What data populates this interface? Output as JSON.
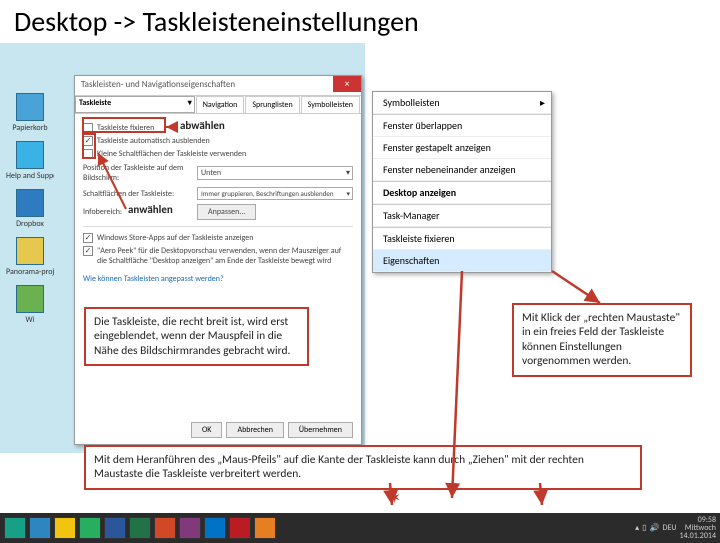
{
  "title": "Desktop -> Taskleisteneinstellungen",
  "desktop_icons": [
    {
      "label": "Papierkorb"
    },
    {
      "label": "Help and Support"
    },
    {
      "label": "Dropbox"
    },
    {
      "label": "Panorama-projekt"
    },
    {
      "label": "Wi"
    }
  ],
  "dialog": {
    "window_title": "Taskleisten- und Navigationseigenschaften",
    "tabs": [
      "Taskleiste",
      "Navigation",
      "Sprunglisten",
      "Symbolleisten"
    ],
    "chk_fix": "Taskleiste fixieren",
    "chk_autohide": "Taskleiste automatisch ausblenden",
    "chk_small": "Kleine Schaltflächen der Taskleiste verwenden",
    "pos_label": "Position der Taskleiste auf dem Bildschirm:",
    "pos_value": "Unten",
    "btn_label": "Schaltflächen der Taskleiste:",
    "btn_value": "Immer gruppieren, Beschriftungen ausblenden",
    "info_label": "Infobereich:",
    "info_btn": "Anpassen...",
    "chk_store": "Windows Store-Apps auf der Taskleiste anzeigen",
    "chk_peek": "\"Aero Peek\" für die Desktopvorschau verwenden, wenn der Mauszeiger auf die Schaltfläche \"Desktop anzeigen\" am Ende der Taskleiste bewegt wird",
    "link": "Wie können Taskleisten angepasst werden?",
    "ok": "OK",
    "cancel": "Abbrechen",
    "apply": "Übernehmen"
  },
  "context_menu": {
    "items": [
      {
        "label": "Symbolleisten",
        "sub": true
      },
      {
        "label": "Fenster überlappen"
      },
      {
        "label": "Fenster gestapelt anzeigen"
      },
      {
        "label": "Fenster nebeneinander anzeigen"
      },
      {
        "label": "Desktop anzeigen",
        "bold": true
      },
      {
        "label": "Task-Manager"
      },
      {
        "label": "Taskleiste fixieren"
      },
      {
        "label": "Eigenschaften",
        "hl": true
      }
    ]
  },
  "annotations": {
    "abwaehlen": "abwählen",
    "anwaehlen": "anwählen",
    "left_note": "Die Taskleiste, die recht breit ist, wird erst eingeblendet, wenn der Mauspfeil in die Nähe des Bildschirmrandes gebracht wird.",
    "right_note": "Mit Klick der „rechten Maustaste\" in ein freies Feld der Taskleiste können Einstellungen vorgenommen werden.",
    "bottom_note": "Mit dem Heranführen des „Maus-Pfeils\" auf die Kante der Taskleiste kann durch „Ziehen\" mit der rechten Maustaste die Taskleiste verbreitert werden."
  },
  "taskbar": {
    "icons": [
      "start",
      "ie",
      "explorer",
      "store",
      "word",
      "excel",
      "ppt",
      "onenote",
      "mail",
      "reader",
      "media"
    ],
    "lang": "DEU",
    "day": "Mittwoch",
    "time": "09:58",
    "date": "14.01.2014"
  },
  "colors": {
    "accent": "#c0392b",
    "hl": "#d6ebff"
  }
}
